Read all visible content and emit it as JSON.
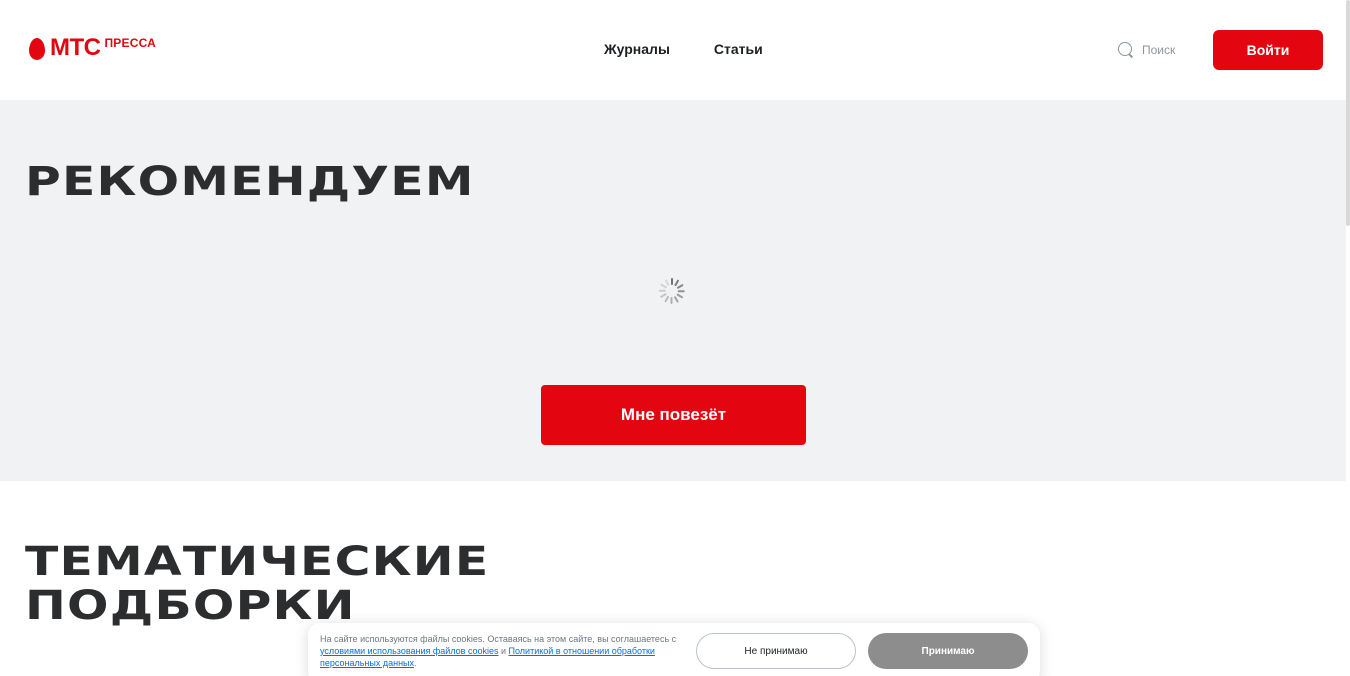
{
  "header": {
    "logo_mts": "МТС",
    "logo_press": "ПРЕССА",
    "nav": [
      {
        "label": "Журналы"
      },
      {
        "label": "Статьи"
      }
    ],
    "search_placeholder": "Поиск",
    "login_label": "Войти"
  },
  "recommend": {
    "title": "РЕКОМЕНДУЕМ",
    "lucky_button": "Мне повезёт"
  },
  "thematic": {
    "title_line1": "ТЕМАТИЧЕСКИЕ",
    "title_line2": "ПОДБОРКИ"
  },
  "cookie": {
    "text_before": "На сайте используются файлы cookies. Оставаясь на этом сайте, вы соглашаетесь с ",
    "link1": "условиями использования файлов cookies",
    "text_mid": " и ",
    "link2": "Политикой в отношении обработки персональных данных",
    "text_after": ".",
    "reject_label": "Не принимаю",
    "accept_label": "Принимаю"
  },
  "colors": {
    "brand_red": "#e30611",
    "section_bg": "#f1f2f4",
    "heading": "#2c2d2f",
    "accept_gray": "#8d8d8d"
  }
}
